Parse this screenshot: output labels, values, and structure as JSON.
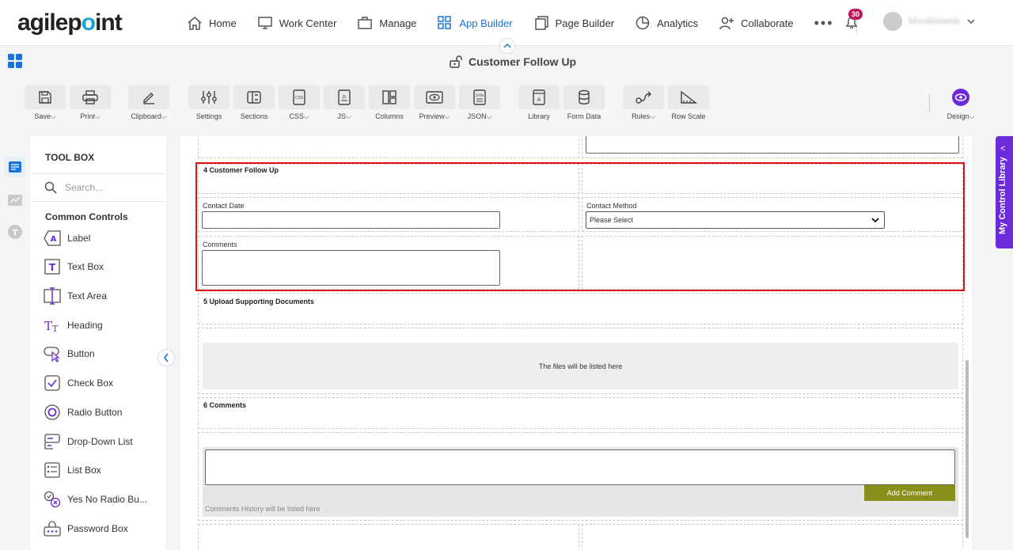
{
  "logo": {
    "text_a": "agilep",
    "text_dot": "o",
    "text_b": "int"
  },
  "nav": {
    "items": [
      {
        "label": "Home"
      },
      {
        "label": "Work Center"
      },
      {
        "label": "Manage"
      },
      {
        "label": "App Builder"
      },
      {
        "label": "Page Builder"
      },
      {
        "label": "Analytics"
      },
      {
        "label": "Collaborate"
      }
    ],
    "more": "•••",
    "notifications": "30",
    "user_name": "MuraliGowda"
  },
  "form_title": "Customer Follow Up",
  "toolbar": {
    "save": "Save",
    "print": "Print",
    "clipboard": "Clipboard",
    "settings": "Settings",
    "sections": "Sections",
    "css": "CSS",
    "js": "JS",
    "columns": "Columns",
    "preview": "Preview",
    "json": "JSON",
    "library": "Library",
    "form_data": "Form Data",
    "rules": "Rules",
    "row_scale": "Row Scale",
    "design": "Design"
  },
  "toolbox": {
    "title": "TOOL BOX",
    "search_placeholder": "Search...",
    "category": "Common Controls",
    "controls": [
      {
        "label": "Label"
      },
      {
        "label": "Text Box"
      },
      {
        "label": "Text Area"
      },
      {
        "label": "Heading"
      },
      {
        "label": "Button"
      },
      {
        "label": "Check Box"
      },
      {
        "label": "Radio Button"
      },
      {
        "label": "Drop-Down List"
      },
      {
        "label": "List Box"
      },
      {
        "label": "Yes No Radio Bu..."
      },
      {
        "label": "Password Box"
      }
    ]
  },
  "form": {
    "section4_title": "4 Customer Follow Up",
    "contact_date_label": "Contact Date",
    "contact_method_label": "Contact Method",
    "contact_method_value": "Please Select",
    "comments_label": "Comments",
    "section5_title": "5 Upload Supporting Documents",
    "files_placeholder": "The files will be listed here",
    "section6_title": "6 Comments",
    "add_comment": "Add Comment",
    "history_text": "Comments History will be listed here"
  },
  "side_tab": "My Control Library",
  "colors": {
    "accent": "#1a73d8",
    "purple": "#6c2bd9",
    "highlight": "#d11111",
    "add_button": "#8a8f1a"
  }
}
